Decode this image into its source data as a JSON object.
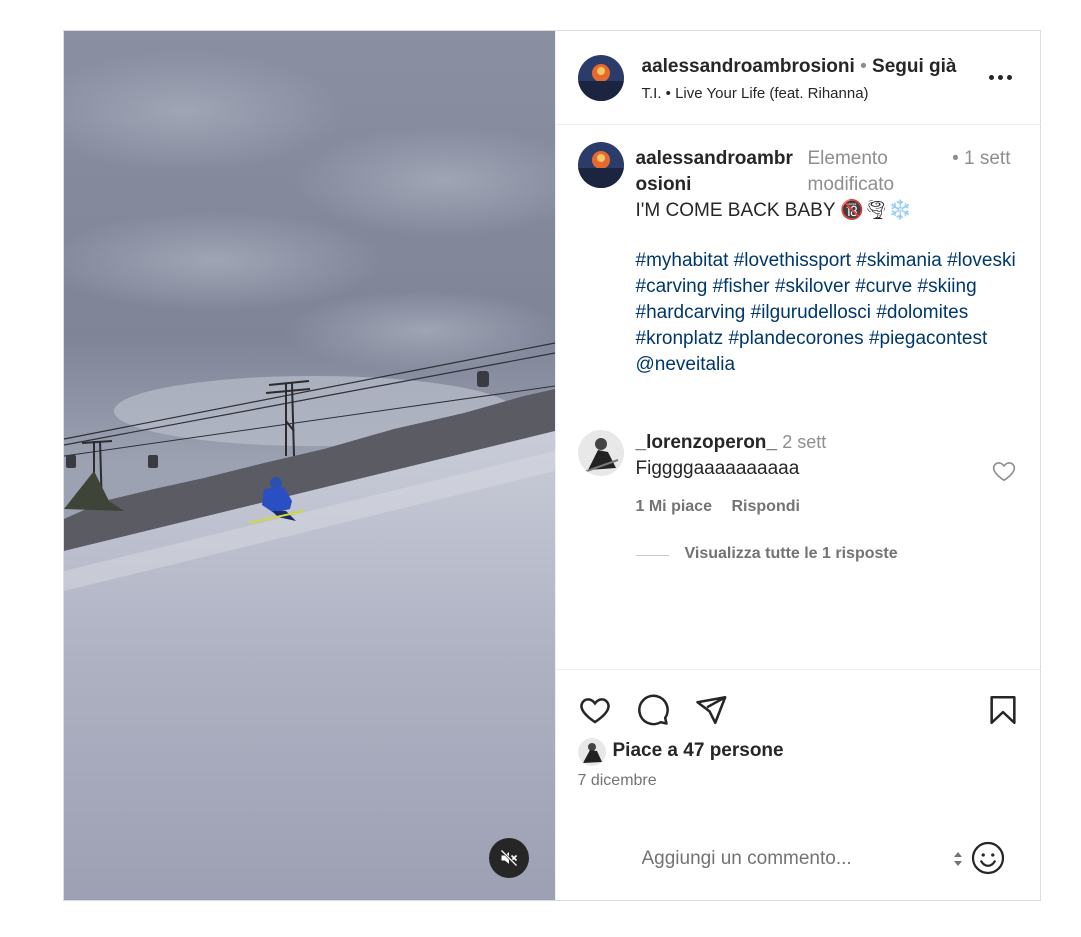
{
  "header": {
    "username": "aalessandroambrosioni",
    "separator": "•",
    "follow_status": "Segui già",
    "music": "T.I. • Live Your Life (feat. Rihanna)",
    "more_icon": "more-horizontal-icon"
  },
  "caption": {
    "username": "aalessandroambrosioni",
    "edited": "Elemento modificato",
    "time": "• 1 sett",
    "text": "I'M COME BACK BABY 🔞🌪❄️",
    "hashtags": [
      "#myhabitat",
      "#lovethissport",
      "#skimania",
      "#loveski",
      "#carving",
      "#fisher",
      "#skilover",
      "#curve",
      "#skiing",
      "#hardcarving",
      "#ilgurudellosci",
      "#dolomites",
      "#kronplatz",
      "#plandecorones",
      "#piegacontest",
      "@neveitalia"
    ]
  },
  "comment": {
    "username": "_lorenzoperon_",
    "time": "2 sett",
    "text": "Figgggaaaaaaaaaa",
    "likes": "1 Mi piace",
    "reply": "Rispondi",
    "view_replies": "Visualizza tutte le 1 risposte"
  },
  "actions": {
    "likes": "Piace a 47 persone",
    "date": "7 dicembre"
  },
  "add_comment": {
    "placeholder": "Aggiungi un commento..."
  },
  "media": {
    "mute_icon": "volume-muted-icon"
  },
  "colors": {
    "hashtag": "#00376b",
    "secondary_text": "#737373",
    "border": "#dbdbdb"
  }
}
